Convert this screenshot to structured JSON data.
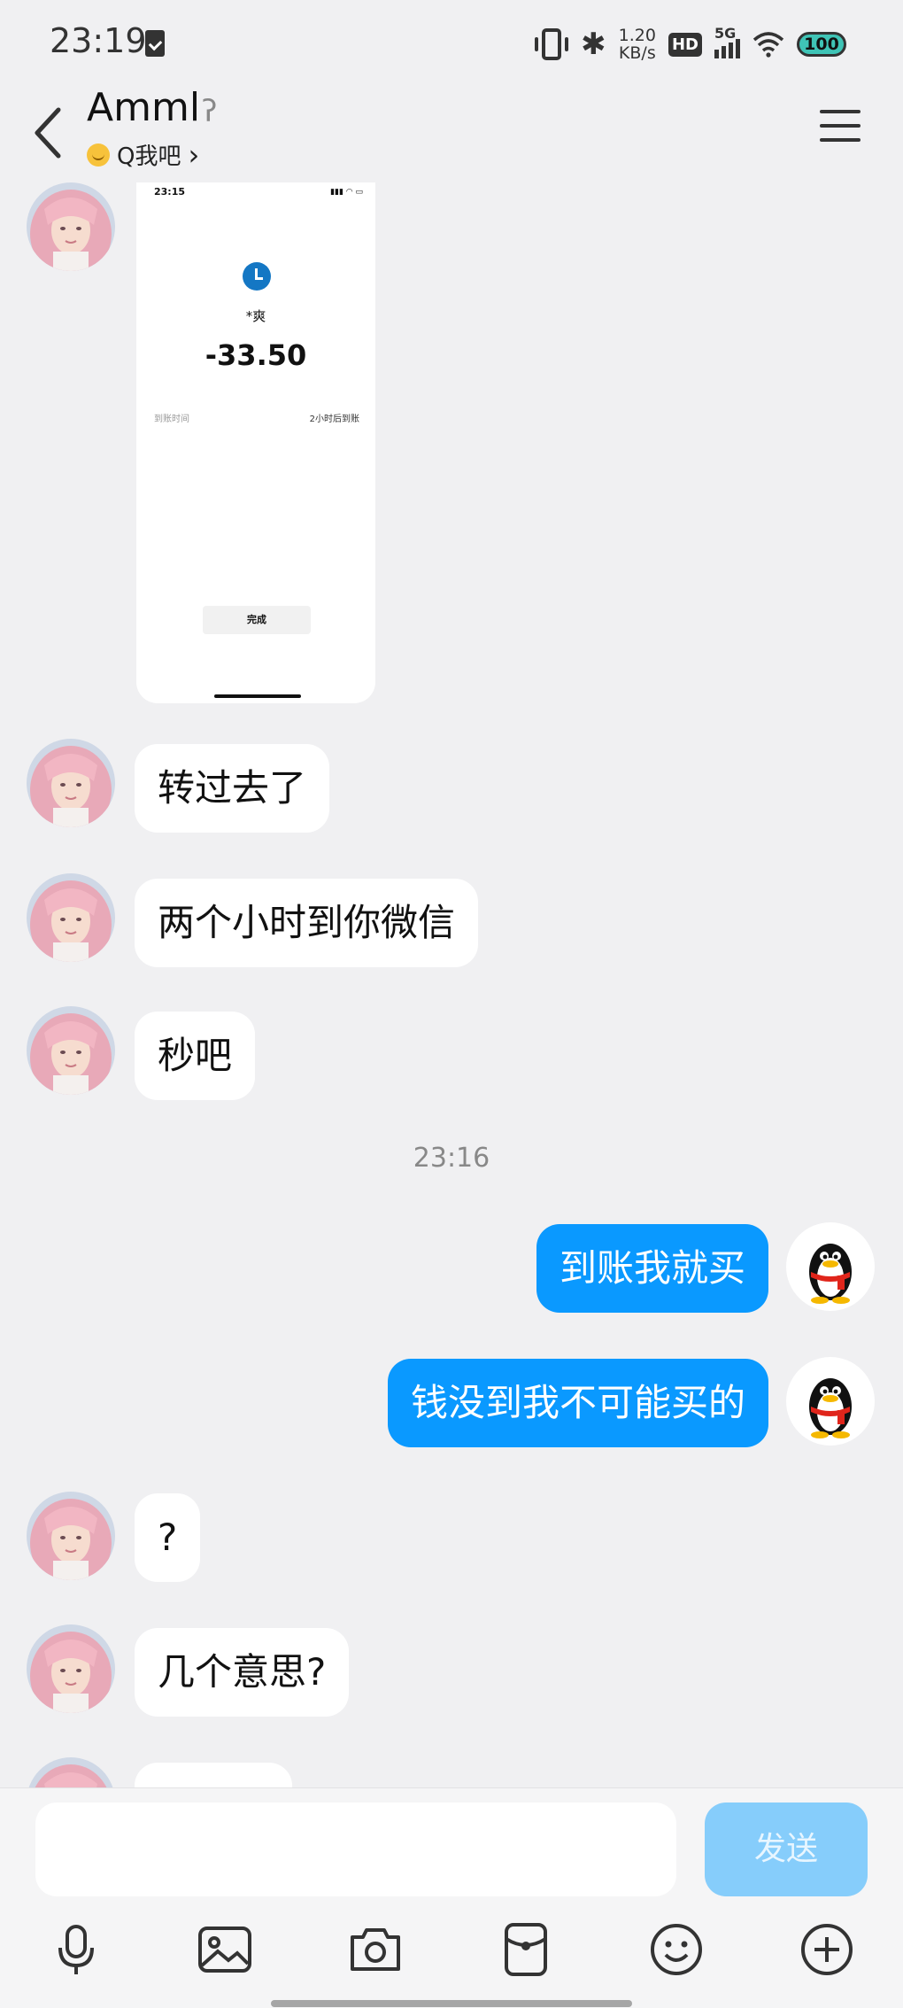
{
  "status_bar": {
    "time": "23:19",
    "speed_value": "1.20",
    "speed_unit": "KB/s",
    "hd": "HD",
    "network": "5G",
    "battery": "100"
  },
  "header": {
    "title": "Amml",
    "subtitle": "Q我吧",
    "subtitle_chevron": "›"
  },
  "shared_screenshot": {
    "time": "23:15",
    "payee": "*爽",
    "amount": "-33.50",
    "row_label": "到账时间",
    "row_value": "2小时后到账",
    "button": "完成"
  },
  "messages": [
    {
      "side": "in",
      "text": "转过去了"
    },
    {
      "side": "in",
      "text": "两个小时到你微信"
    },
    {
      "side": "in",
      "text": "秒吧"
    },
    {
      "side": "out",
      "text": "到账我就买"
    },
    {
      "side": "out",
      "text": "钱没到我不可能买的"
    },
    {
      "side": "in",
      "text": "?"
    },
    {
      "side": "in",
      "text": "几个意思?"
    }
  ],
  "timestamp": "23:16",
  "input": {
    "placeholder": "",
    "send_label": "发送"
  },
  "colors": {
    "background": "#f0f0f2",
    "outgoing_bubble": "#0a99ff",
    "incoming_bubble": "#ffffff",
    "send_button": "#86cdfb"
  },
  "icons": [
    "microphone-icon",
    "image-icon",
    "camera-icon",
    "red-packet-icon",
    "emoji-icon",
    "plus-icon"
  ]
}
